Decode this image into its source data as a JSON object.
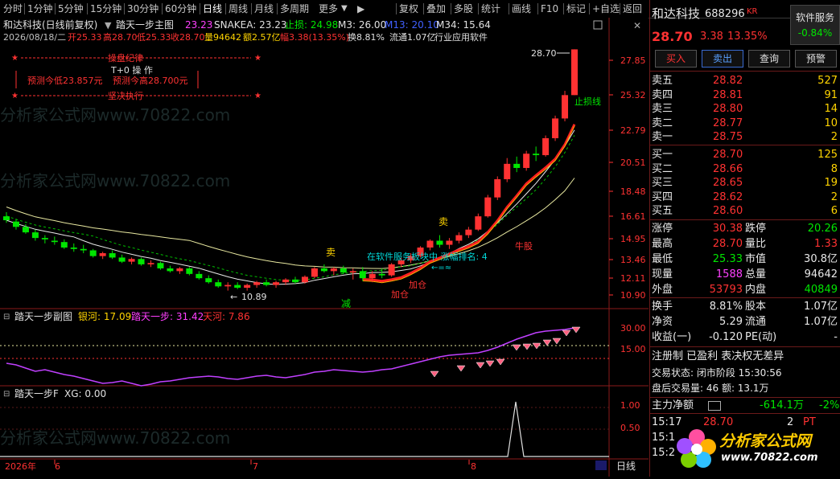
{
  "toolbar": {
    "periods": [
      "分时",
      "1分钟",
      "5分钟",
      "15分钟",
      "30分钟",
      "60分钟",
      "日线",
      "周线",
      "月线",
      "多周期",
      "更多"
    ],
    "active_period": "日线",
    "tools": [
      "复权",
      "叠加",
      "多股",
      "统计",
      "画线",
      "F10",
      "标记",
      "+自选",
      "返回"
    ]
  },
  "header": {
    "stock_title": "和达科技(日线前复权)",
    "main_indicator": "踏天一步主图",
    "ind_val_1": "23.23",
    "snakea": "SNAKEA: 23.23",
    "stop_loss": "止损: 24.98",
    "m3": "M3: 26.00",
    "m13": "M13: 20.10",
    "m34": "M34: 15.64",
    "line2_date": "2026/08/18/二",
    "open": "开25.33",
    "high": "高28.70",
    "low": "低25.33",
    "close": "收28.70",
    "volume": "量94642",
    "amount": "额2.57亿",
    "amp": "幅3.38(13.35%)",
    "turnover": "换8.81%",
    "float": "流通1.07亿",
    "industry": "行业应用软件"
  },
  "annotations": {
    "discipline": "操盘纪律",
    "t0": "T+0 操 作",
    "pred_low": "预测今低23.857元",
    "pred_high": "预测今高28.700元",
    "firm": "坚决执行",
    "stop_line": "止损线",
    "sell1": "卖",
    "sell2": "卖",
    "reduce": "减",
    "add1": "加仓",
    "add2": "加仓",
    "cow": "牛股",
    "sector": "在软件服务板块中 涨幅排名: 4",
    "arrow_eq": "←=≈",
    "last_price": "28.70",
    "low_price": "10.89"
  },
  "price_axis": [
    "27.85",
    "25.32",
    "22.79",
    "20.51",
    "18.48",
    "16.61",
    "14.95",
    "13.46",
    "12.11",
    "10.90"
  ],
  "sub1": {
    "title": "踏天一步副图",
    "yinhe": "银河: 17.09",
    "tatian": "踏天一步: 31.42",
    "tianhe": "天河: 7.86",
    "axis": [
      "30.00",
      "15.00"
    ]
  },
  "sub2": {
    "title": "踏天一步F",
    "xg": "XG: 0.00",
    "axis": [
      "1.00",
      "0.50"
    ]
  },
  "time_axis": {
    "year": "2026年",
    "m6": "6",
    "m7": "7",
    "m8": "8",
    "period": "日线"
  },
  "watermark": [
    "分析家公式网www.70822.com",
    "分析家公式网www.70822.com",
    "分析家公式网www.70822.com"
  ],
  "right": {
    "name": "和达科技",
    "code": "688296",
    "tag": "KR",
    "sector_btn": "软件服务",
    "sector_chg": "-0.84%",
    "price": "28.70",
    "chg": "3.38",
    "pct": "13.35%",
    "buttons": [
      "买入",
      "卖出",
      "查询",
      "预警"
    ],
    "asks": [
      {
        "label": "卖五",
        "price": "28.82",
        "vol": "527"
      },
      {
        "label": "卖四",
        "price": "28.81",
        "vol": "91"
      },
      {
        "label": "卖三",
        "price": "28.80",
        "vol": "14"
      },
      {
        "label": "卖二",
        "price": "28.77",
        "vol": "10"
      },
      {
        "label": "卖一",
        "price": "28.75",
        "vol": "2"
      }
    ],
    "bids": [
      {
        "label": "买一",
        "price": "28.70",
        "vol": "125"
      },
      {
        "label": "买二",
        "price": "28.66",
        "vol": "8"
      },
      {
        "label": "买三",
        "price": "28.65",
        "vol": "19"
      },
      {
        "label": "买四",
        "price": "28.62",
        "vol": "2"
      },
      {
        "label": "买五",
        "price": "28.60",
        "vol": "6"
      }
    ],
    "stats": [
      {
        "l1": "涨停",
        "v1": "30.38",
        "l2": "跌停",
        "v2": "20.26"
      },
      {
        "l1": "最高",
        "v1": "28.70",
        "l2": "量比",
        "v2": "1.33"
      },
      {
        "l1": "最低",
        "v1": "25.33",
        "l2": "市值",
        "v2": "30.8亿"
      },
      {
        "l1": "现量",
        "v1": "1588",
        "l2": "总量",
        "v2": "94642"
      },
      {
        "l1": "外盘",
        "v1": "53793",
        "l2": "内盘",
        "v2": "40849"
      }
    ],
    "fund": [
      {
        "l1": "换手",
        "v1": "8.81%",
        "l2": "股本",
        "v2": "1.07亿"
      },
      {
        "l1": "净资",
        "v1": "5.29",
        "l2": "流通",
        "v2": "1.07亿"
      },
      {
        "l1": "收益(一)",
        "v1": "-0.120",
        "l2": "PE(动)",
        "v2": "-"
      }
    ],
    "registration": "注册制 已盈利 表决权无差异",
    "trade_status": "交易状态: 闭市阶段 15:30:56",
    "after_hours": "盘后交易量: 46  额: 13.1万",
    "main_flow_label": "主力净额",
    "main_flow_val": "-614.1万",
    "main_flow_pct": "-2%",
    "ticks": [
      {
        "time": "15:17",
        "price": "28.70",
        "vol": "2",
        "side": "PT"
      },
      {
        "time": "15:1",
        "price": "",
        "vol": "",
        "side": ""
      },
      {
        "time": "15:2",
        "price": "",
        "vol": "",
        "side": ""
      }
    ],
    "logo_text": "分析家公式网",
    "logo_url": "www.70822.com"
  },
  "chart_data": {
    "type": "candlestick",
    "ylim": [
      10.5,
      29.5
    ],
    "candles": [
      [
        16.6,
        16.9,
        16.1,
        16.3
      ],
      [
        16.2,
        16.4,
        15.6,
        15.8
      ],
      [
        15.8,
        16.0,
        15.3,
        15.4
      ],
      [
        15.4,
        15.6,
        14.8,
        15.0
      ],
      [
        15.0,
        15.2,
        14.6,
        14.9
      ],
      [
        14.8,
        15.1,
        14.5,
        14.7
      ],
      [
        14.7,
        14.9,
        14.2,
        14.3
      ],
      [
        14.3,
        14.6,
        14.0,
        14.2
      ],
      [
        14.2,
        14.5,
        13.9,
        14.1
      ],
      [
        14.1,
        14.2,
        13.6,
        13.7
      ],
      [
        13.7,
        14.0,
        13.5,
        13.9
      ],
      [
        13.9,
        14.1,
        13.5,
        13.6
      ],
      [
        13.6,
        13.8,
        13.2,
        13.3
      ],
      [
        13.3,
        13.6,
        13.1,
        13.5
      ],
      [
        13.5,
        13.6,
        13.0,
        13.1
      ],
      [
        13.1,
        13.4,
        12.9,
        13.2
      ],
      [
        13.2,
        13.3,
        12.7,
        12.8
      ],
      [
        12.8,
        13.0,
        12.5,
        12.6
      ],
      [
        12.6,
        12.9,
        12.4,
        12.8
      ],
      [
        12.8,
        12.9,
        12.3,
        12.4
      ],
      [
        12.4,
        12.6,
        12.0,
        12.1
      ],
      [
        12.1,
        12.3,
        11.7,
        11.8
      ],
      [
        11.8,
        12.0,
        11.4,
        11.5
      ],
      [
        11.5,
        11.8,
        11.2,
        11.6
      ],
      [
        11.6,
        11.8,
        11.3,
        11.4
      ],
      [
        11.4,
        11.7,
        11.2,
        11.6
      ],
      [
        11.6,
        11.9,
        11.4,
        11.8
      ],
      [
        11.8,
        12.0,
        11.5,
        11.6
      ],
      [
        11.6,
        11.9,
        11.4,
        11.8
      ],
      [
        11.8,
        12.1,
        11.6,
        12.0
      ],
      [
        12.0,
        12.2,
        11.7,
        11.8
      ],
      [
        11.8,
        12.3,
        11.7,
        12.2
      ],
      [
        12.2,
        12.9,
        12.1,
        12.8
      ],
      [
        12.8,
        13.1,
        12.5,
        12.6
      ],
      [
        12.6,
        12.9,
        12.3,
        12.8
      ],
      [
        12.8,
        13.0,
        12.4,
        12.5
      ],
      [
        12.5,
        12.8,
        12.0,
        12.6
      ],
      [
        12.6,
        12.9,
        11.9,
        12.1
      ],
      [
        12.1,
        12.6,
        11.8,
        12.4
      ],
      [
        12.4,
        12.8,
        12.1,
        12.3
      ],
      [
        12.3,
        13.2,
        12.2,
        13.1
      ],
      [
        13.1,
        13.6,
        12.9,
        13.4
      ],
      [
        13.4,
        13.9,
        13.2,
        13.7
      ],
      [
        13.7,
        14.4,
        13.6,
        14.3
      ],
      [
        14.3,
        14.9,
        14.1,
        14.8
      ],
      [
        14.8,
        15.2,
        14.3,
        14.5
      ],
      [
        14.5,
        15.0,
        14.2,
        14.8
      ],
      [
        14.8,
        15.4,
        14.6,
        15.2
      ],
      [
        15.2,
        15.8,
        15.0,
        15.6
      ],
      [
        15.6,
        16.8,
        15.5,
        16.6
      ],
      [
        16.6,
        18.2,
        16.5,
        18.0
      ],
      [
        18.0,
        19.5,
        17.8,
        19.3
      ],
      [
        19.3,
        20.8,
        19.1,
        20.4
      ],
      [
        20.4,
        20.9,
        19.8,
        20.1
      ],
      [
        20.1,
        21.3,
        19.9,
        21.1
      ],
      [
        21.1,
        21.6,
        20.6,
        21.0
      ],
      [
        21.0,
        22.4,
        20.9,
        22.2
      ],
      [
        22.2,
        23.8,
        22.0,
        23.6
      ],
      [
        23.6,
        25.6,
        23.4,
        25.3
      ],
      [
        25.3,
        28.7,
        25.3,
        28.7
      ]
    ]
  }
}
